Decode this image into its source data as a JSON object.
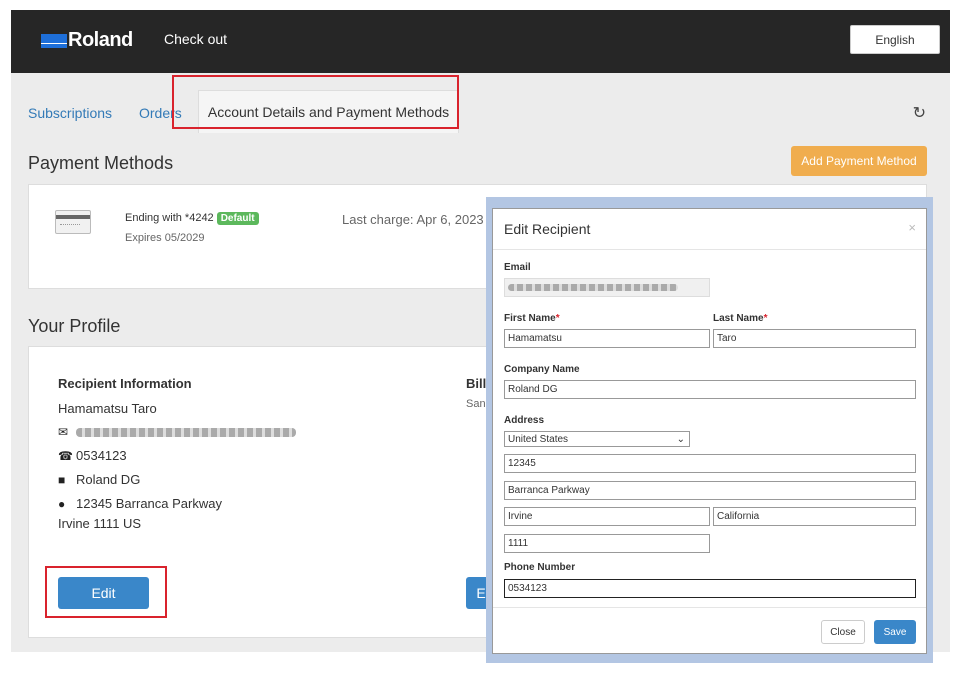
{
  "header": {
    "brand": "Roland",
    "checkout": "Check out",
    "language": "English"
  },
  "tabs": {
    "items": [
      {
        "label": "Subscriptions"
      },
      {
        "label": "Orders"
      },
      {
        "label": "Account Details and Payment Methods",
        "active": true
      }
    ]
  },
  "payment": {
    "title": "Payment Methods",
    "add_button": "Add Payment Method",
    "card": {
      "ending": "Ending with *4242",
      "badge": "Default",
      "expires": "Expires 05/2029",
      "last_charge": "Last charge: Apr 6, 2023"
    }
  },
  "profile": {
    "title": "Your Profile",
    "recipient_heading": "Recipient Information",
    "name": "Hamamatsu Taro",
    "phone": "0534123",
    "company": "Roland DG",
    "address_line1": "12345 Barranca Parkway",
    "address_line2": "Irvine 1111 US",
    "edit_button": "Edit",
    "billing_heading": "Bill",
    "billing_sub": "San",
    "billing_button": "E"
  },
  "modal": {
    "title": "Edit Recipient",
    "close_x": "×",
    "email_label": "Email",
    "first_name_label": "First Name",
    "first_name": "Hamamatsu",
    "last_name_label": "Last Name",
    "last_name": "Taro",
    "company_label": "Company Name",
    "company": "Roland DG",
    "address_label": "Address",
    "country": "United States",
    "address1": "12345",
    "address2": "Barranca Parkway",
    "city": "Irvine",
    "state": "California",
    "zip": "1111",
    "phone_label": "Phone Number",
    "phone": "0534123",
    "close_button": "Close",
    "save_button": "Save"
  },
  "colors": {
    "accent_blue": "#3a87c9",
    "orange": "#f0ad4e",
    "highlight_red": "#d9232d",
    "badge_green": "#5cb85c"
  }
}
